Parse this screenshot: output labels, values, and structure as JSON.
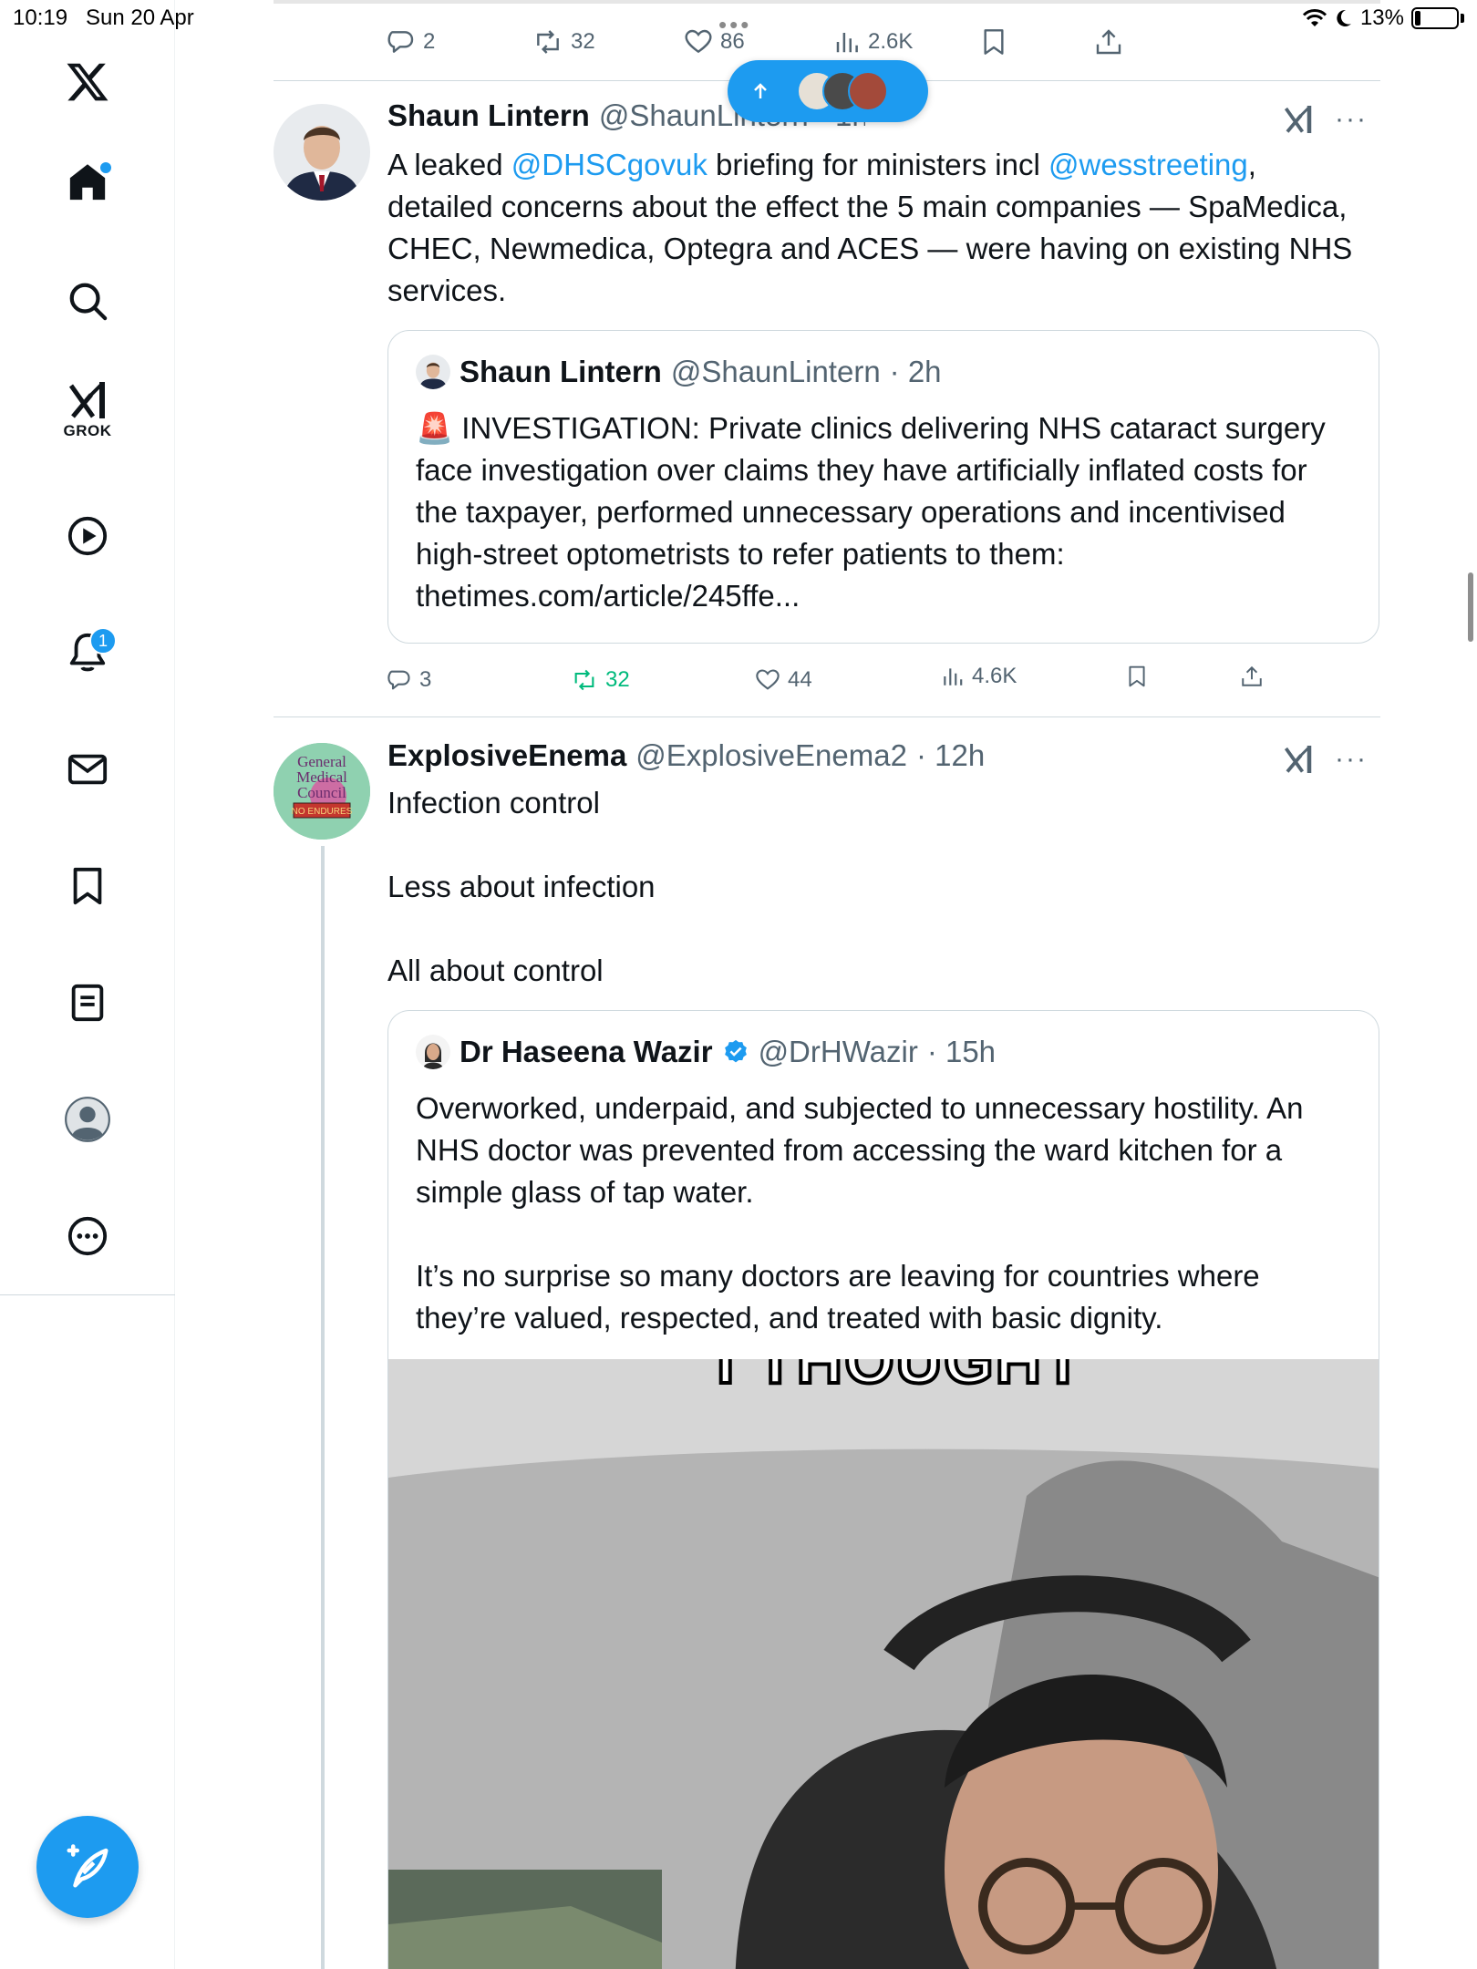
{
  "status_bar": {
    "time": "10:19",
    "date": "Sun 20 Apr",
    "battery": "13%"
  },
  "sidebar": {
    "items": [
      {
        "name": "home"
      },
      {
        "name": "explore"
      },
      {
        "name": "grok",
        "label": "GROK"
      },
      {
        "name": "video"
      },
      {
        "name": "notifications",
        "badge": "1"
      },
      {
        "name": "messages"
      },
      {
        "name": "bookmarks"
      },
      {
        "name": "lists"
      },
      {
        "name": "profile"
      },
      {
        "name": "more"
      }
    ]
  },
  "previous_tweet": {
    "actions": {
      "replies": "2",
      "reposts": "32",
      "likes": "86",
      "views": "2.6K"
    }
  },
  "tweet1": {
    "name": "Shaun Lintern",
    "handle": "@ShaunLintern · 1h",
    "text_parts": {
      "a": "A leaked ",
      "mention1": "@DHSCgovuk",
      "b": " briefing for ministers incl ",
      "mention2": "@wesstreeting",
      "c": ", detailed concerns about the effect the 5 main companies — SpaMedica, CHEC, Newmedica, Optegra and ACES — were having on existing NHS services."
    },
    "quote": {
      "name": "Shaun Lintern",
      "handle": "@ShaunLintern",
      "time": "· 2h",
      "emoji": "🚨",
      "text": " INVESTIGATION: Private clinics delivering NHS cataract surgery face investigation over claims they have artificially inflated costs for the taxpayer, performed unnecessary operations and incentivised high-street optometrists to refer patients to them:  thetimes.com/article/245ffe..."
    },
    "actions": {
      "replies": "3",
      "reposts": "32",
      "likes": "44",
      "views": "4.6K"
    }
  },
  "tweet2": {
    "name": "ExplosiveEnema",
    "handle": "@ExplosiveEnema2",
    "time": "· 12h",
    "avatar_text": [
      "General",
      "Medical",
      "Council",
      "NO ENDURES"
    ],
    "lines": [
      "Infection control",
      "Less about infection",
      "All about control"
    ],
    "quote": {
      "name": "Dr Haseena Wazir",
      "handle": "@DrHWazir",
      "time": "· 15h",
      "para1": "Overworked, underpaid, and subjected to unnecessary hostility. An NHS doctor was prevented from accessing the ward kitchen for a simple glass of tap water.",
      "para2": "It’s no surprise so many doctors are leaving for countries where they’re valued, respected, and treated with basic dignity.",
      "video_caption": "I THOUGHT"
    }
  },
  "colors": {
    "accent": "#1d9bf0",
    "repost_active": "#00ba7c",
    "secondary_text": "#536471",
    "divider": "#cfd9de"
  }
}
